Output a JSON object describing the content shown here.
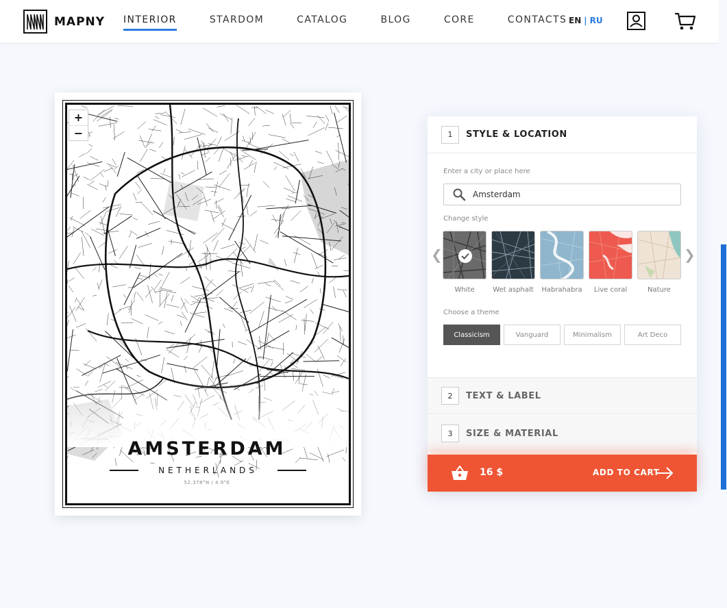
{
  "brand": {
    "name": "MAPNY"
  },
  "nav": {
    "items": [
      {
        "label": "INTERIOR",
        "active": true
      },
      {
        "label": "STARDOM"
      },
      {
        "label": "CATALOG"
      },
      {
        "label": "BLOG"
      },
      {
        "label": "CORE"
      },
      {
        "label": "CONTACTS"
      }
    ]
  },
  "lang": {
    "en": "EN",
    "sep": "|",
    "ru": "RU"
  },
  "poster": {
    "zoom_in": "+",
    "zoom_out": "−",
    "city": "AMSTERDAM",
    "country": "NETHERLANDS",
    "coords": "52.378°N / 4.9°E"
  },
  "panel": {
    "step1": {
      "num": "1",
      "title": "STYLE & LOCATION"
    },
    "location_label": "Enter a city or place here",
    "location_value": "Amsterdam",
    "style_label": "Change style",
    "styles": [
      {
        "label": "White",
        "selected": true
      },
      {
        "label": "Wet asphalt"
      },
      {
        "label": "Habrahabra"
      },
      {
        "label": "Live coral"
      },
      {
        "label": "Nature"
      }
    ],
    "theme_label": "Choose a theme",
    "themes": [
      {
        "label": "Classicism",
        "active": true
      },
      {
        "label": "Vanguard"
      },
      {
        "label": "Minimalism"
      },
      {
        "label": "Art Deco"
      }
    ],
    "step2": {
      "num": "2",
      "title": "TEXT & LABEL"
    },
    "step3": {
      "num": "3",
      "title": "SIZE & MATERIAL"
    },
    "price": "16 $",
    "add_to_cart": "ADD TO CART"
  },
  "colors": {
    "accent": "#2b7be0",
    "cart": "#ef5534",
    "scrollbar": "#1b6fd6"
  }
}
